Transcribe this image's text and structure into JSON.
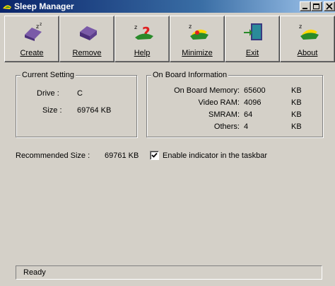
{
  "window": {
    "title": "Sleep Manager",
    "controls": {
      "minimize": "minimize-icon",
      "maximize": "maximize-icon",
      "close": "close-icon"
    }
  },
  "toolbar": {
    "buttons": [
      {
        "label": "Create",
        "icon": "create-sleep-icon"
      },
      {
        "label": "Remove",
        "icon": "remove-bed-icon"
      },
      {
        "label": "Help",
        "icon": "help-question-icon"
      },
      {
        "label": "Minimize",
        "icon": "minimize-sleeper-icon"
      },
      {
        "label": "Exit",
        "icon": "exit-door-icon"
      },
      {
        "label": "About",
        "icon": "about-sleeper-icon"
      }
    ]
  },
  "current_setting": {
    "title": "Current Setting",
    "drive_label": "Drive :",
    "drive_value": "C",
    "size_label": "Size :",
    "size_value": "69764 KB"
  },
  "on_board": {
    "title": "On Board Information",
    "rows": [
      {
        "label": "On Board Memory:",
        "value": "65600",
        "unit": "KB"
      },
      {
        "label": "Video RAM:",
        "value": "4096",
        "unit": "KB"
      },
      {
        "label": "SMRAM:",
        "value": "64",
        "unit": "KB"
      },
      {
        "label": "Others:",
        "value": "4",
        "unit": "KB"
      }
    ]
  },
  "recommended": {
    "label": "Recommended Size :",
    "value": "69761 KB"
  },
  "indicator": {
    "label": "Enable indicator in the taskbar",
    "checked": true
  },
  "status": {
    "text": "Ready"
  },
  "colors": {
    "face": "#d4d0c8",
    "title_start": "#0a246a",
    "title_end": "#a6caf0"
  }
}
